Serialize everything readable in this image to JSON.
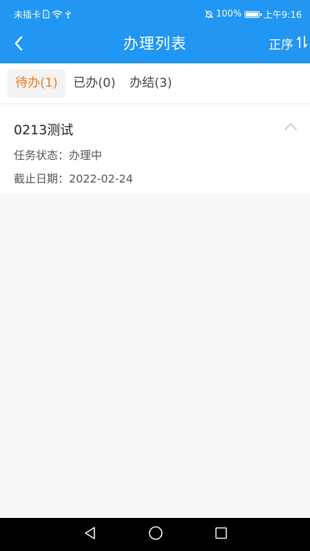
{
  "status_bar": {
    "carrier": "未插卡",
    "battery_percent": "100%",
    "battery_level": 1.0,
    "time": "上午9:16",
    "icons": [
      "sim-icon",
      "wifi-icon",
      "usb-icon",
      "mute-icon",
      "battery-icon"
    ]
  },
  "header": {
    "title": "办理列表",
    "sort_label": "正序",
    "back_icon": "back-arrow-icon",
    "sort_icon": "sort-icon"
  },
  "tabs": [
    {
      "label": "待办(1)",
      "active": true
    },
    {
      "label": "已办(0)",
      "active": false
    },
    {
      "label": "办结(3)",
      "active": false
    }
  ],
  "items": [
    {
      "title": "0213测试",
      "status_label": "任务状态：",
      "status_value": "办理中",
      "deadline_label": "截止日期：",
      "deadline_value": "2022-02-24",
      "toggle_icon": "chevron-up-icon"
    }
  ],
  "nav_bar": {
    "icons": [
      "back-triangle-icon",
      "home-circle-icon",
      "recents-square-icon"
    ]
  },
  "colors": {
    "primary": "#2196f3",
    "accent": "#ef7a1a",
    "background": "#f8f8f8",
    "nav_bar": "#000000"
  }
}
